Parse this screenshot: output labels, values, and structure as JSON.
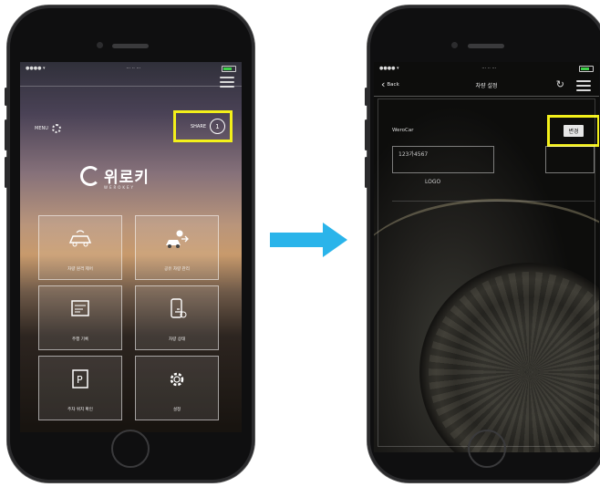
{
  "left_phone": {
    "logo_text": "위로키",
    "logo_sub": "WEROKEY",
    "small_link": "MENU",
    "toggle_label": "SHARE",
    "toggle_symbol": "1",
    "tiles": [
      {
        "label": "차량 원격 제어",
        "icon": "car-remote-icon"
      },
      {
        "label": "공유 차량 관리",
        "icon": "car-share-icon"
      },
      {
        "label": "주행 기록",
        "icon": "logbook-icon"
      },
      {
        "label": "차량 상태",
        "icon": "phone-car-icon"
      },
      {
        "label": "주차 위치 확인",
        "icon": "parking-icon"
      },
      {
        "label": "설정",
        "icon": "gear-icon"
      }
    ]
  },
  "right_phone": {
    "back_label": "Back",
    "nav_title": "차량 설정",
    "form_label": "WeroCar",
    "field_value": "123가4567",
    "field_value_2": "LOGO",
    "confirm_label": "변경"
  },
  "colors": {
    "highlight": "#f3f01a",
    "arrow": "#2ab4ea"
  }
}
